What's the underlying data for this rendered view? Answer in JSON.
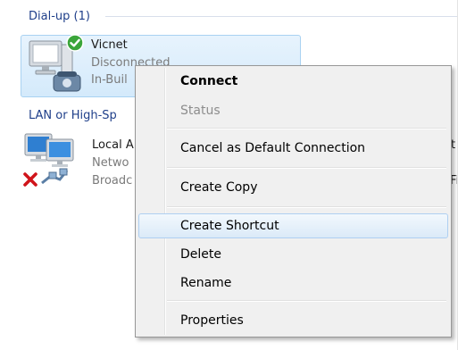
{
  "groups": [
    {
      "label": "Dial-up (1)"
    },
    {
      "label": "LAN or High-Sp"
    }
  ],
  "items": [
    {
      "name": "Vicnet",
      "status": "Disconnected",
      "device": "In-Buil"
    },
    {
      "name": "Local A",
      "status": "Netwo",
      "device": "Broadc"
    }
  ],
  "right_clip": {
    "line1": "t",
    "line2": "Fi"
  },
  "context_menu": {
    "items": [
      {
        "label": "Connect"
      },
      {
        "label": "Status"
      },
      {
        "label": "Cancel as Default Connection"
      },
      {
        "label": "Create Copy"
      },
      {
        "label": "Create Shortcut"
      },
      {
        "label": "Delete"
      },
      {
        "label": "Rename"
      },
      {
        "label": "Properties"
      }
    ]
  },
  "colors": {
    "group_header": "#1f3f8a",
    "selection_bg": "#dcedfc",
    "selection_border": "#a9d2f2",
    "menu_bg": "#f0f0f0",
    "menu_hover": "#dbeaf8",
    "disabled_text": "#8d8d8d",
    "status_ok": "#3aa53a",
    "status_error": "#d0141a"
  },
  "icons": {
    "vicnet": "dialup-computer-phone-icon",
    "vicnet_status": "green-check-icon",
    "lan": "network-computers-icon",
    "lan_status": "red-x-icon",
    "lan_cable": "network-cable-icon"
  }
}
